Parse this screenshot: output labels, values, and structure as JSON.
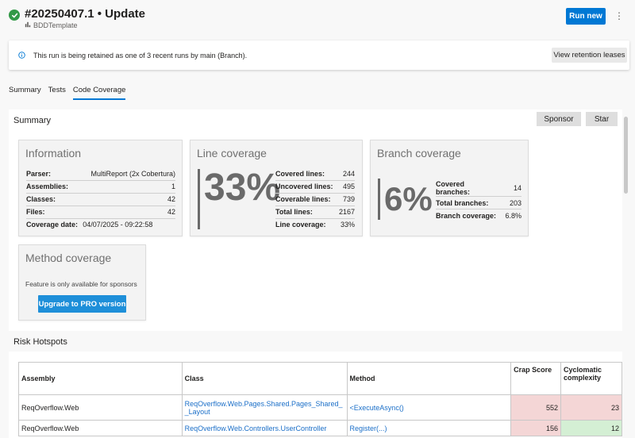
{
  "header": {
    "title": "#20250407.1 • Update",
    "pipeline": "BDDTemplate",
    "run_new_label": "Run new",
    "more_label": "⋮"
  },
  "banner": {
    "text": "This run is being retained as one of 3 recent runs by main (Branch).",
    "button_label": "View retention leases"
  },
  "tabs": [
    {
      "label": "Summary",
      "active": false
    },
    {
      "label": "Tests",
      "active": false
    },
    {
      "label": "Code Coverage",
      "active": true
    }
  ],
  "summary": {
    "title": "Summary",
    "sponsor_label": "Sponsor",
    "star_label": "Star"
  },
  "information": {
    "title": "Information",
    "rows": [
      {
        "key": "Parser:",
        "value": "MultiReport (2x Cobertura)"
      },
      {
        "key": "Assemblies:",
        "value": "1"
      },
      {
        "key": "Classes:",
        "value": "42"
      },
      {
        "key": "Files:",
        "value": "42"
      },
      {
        "key": "Coverage date:",
        "value": "04/07/2025 - 09:22:58"
      }
    ]
  },
  "line_coverage": {
    "title": "Line coverage",
    "percent": "33%",
    "rows": [
      {
        "key": "Covered lines:",
        "value": "244"
      },
      {
        "key": "Uncovered lines:",
        "value": "495"
      },
      {
        "key": "Coverable lines:",
        "value": "739"
      },
      {
        "key": "Total lines:",
        "value": "2167"
      },
      {
        "key": "Line coverage:",
        "value": "33%"
      }
    ]
  },
  "branch_coverage": {
    "title": "Branch coverage",
    "percent": "6%",
    "rows": [
      {
        "key": "Covered branches:",
        "value": "14"
      },
      {
        "key": "Total branches:",
        "value": "203"
      },
      {
        "key": "Branch coverage:",
        "value": "6.8%"
      }
    ]
  },
  "method_coverage": {
    "title": "Method coverage",
    "description": "Feature is only available for sponsors",
    "button_label": "Upgrade to PRO version"
  },
  "risk_hotspots": {
    "title": "Risk Hotspots",
    "columns": [
      "Assembly",
      "Class",
      "Method",
      "Crap Score",
      "Cyclomatic complexity"
    ],
    "rows": [
      {
        "assembly": "ReqOverflow.Web",
        "class": "ReqOverflow.Web.Pages.Shared.Pages_Shared__Layout",
        "method": "<ExecuteAsync()",
        "crap": "552",
        "cyclomatic": "23"
      },
      {
        "assembly": "ReqOverflow.Web",
        "class": "ReqOverflow.Web.Controllers.UserController",
        "method": "Register(...)",
        "crap": "156",
        "cyclomatic": "12"
      }
    ]
  },
  "colors": {
    "accent": "#0078d4",
    "success": "#339947",
    "crap_bad": "#f4d6d6",
    "cyclomatic_good": "#d4efd4"
  }
}
